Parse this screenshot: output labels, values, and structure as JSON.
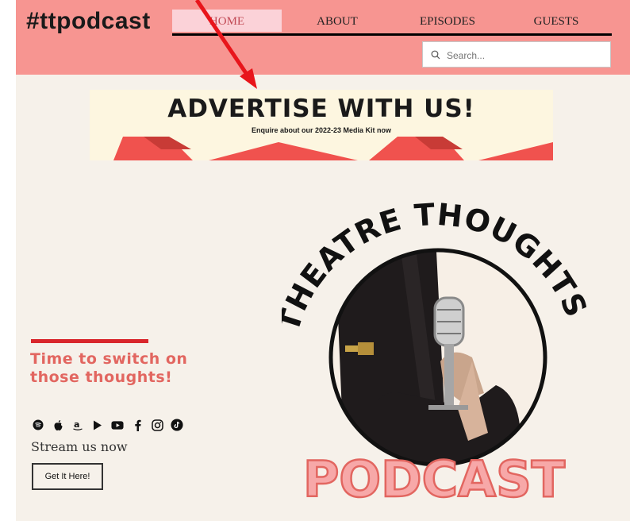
{
  "site": {
    "logo": "#ttpodcast"
  },
  "nav": {
    "items": [
      {
        "label": "HOME",
        "active": true
      },
      {
        "label": "ABOUT",
        "active": false
      },
      {
        "label": "EPISODES",
        "active": false
      },
      {
        "label": "GUESTS",
        "active": false
      }
    ]
  },
  "search": {
    "placeholder": "Search..."
  },
  "ad": {
    "title": "ADVERTISE WITH US!",
    "subtitle": "Enquire about our 2022-23 Media Kit now"
  },
  "hero": {
    "tagline": "Time to switch on those thoughts!",
    "stream_text": "Stream us now",
    "cta_label": "Get It Here!"
  },
  "art": {
    "arc_text": "THEATRE THOUGHTS",
    "podcast_text": "PODCAST"
  },
  "socials": [
    "spotify-icon",
    "apple-icon",
    "amazon-icon",
    "google-play-icon",
    "youtube-icon",
    "facebook-icon",
    "instagram-icon",
    "tiktok-icon"
  ],
  "colors": {
    "header": "#f79591",
    "background": "#f6f1ea",
    "accent": "#e26660",
    "rule": "#d9262c",
    "arrow": "#e8151b"
  }
}
